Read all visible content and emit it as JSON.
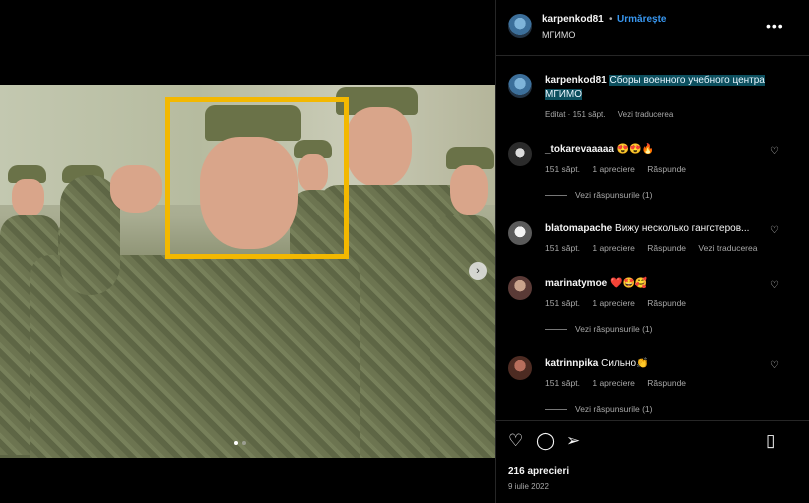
{
  "post": {
    "photo_alt": "soldier-group-photo",
    "highlight_color": "#f3b800"
  },
  "header": {
    "username": "karpenkod81",
    "separator": "•",
    "follow_label": "Urmărește",
    "subtitle": "МГИМО",
    "more": "•••"
  },
  "caption": {
    "username": "karpenkod81",
    "text": "Сборы военного учебного центра МГИМО",
    "edited": "Editat · 151 săpt.",
    "translate": "Vezi traducerea"
  },
  "comments": [
    {
      "username": "_tokarevaaaaa",
      "text": "😍😍🔥",
      "time": "151 săpt.",
      "likes": "1 apreciere",
      "reply": "Răspunde",
      "translate": "",
      "replies": "Vezi răspunsurile (1)"
    },
    {
      "username": "blatomapache",
      "text": "Вижу несколько гангстеров...",
      "time": "151 săpt.",
      "likes": "1 apreciere",
      "reply": "Răspunde",
      "translate": "Vezi traducerea",
      "replies": ""
    },
    {
      "username": "marinatymoe",
      "text": "❤️🤩🥰",
      "time": "151 săpt.",
      "likes": "1 apreciere",
      "reply": "Răspunde",
      "translate": "",
      "replies": "Vezi răspunsurile (1)"
    },
    {
      "username": "katrinnpika",
      "text": "Сильно👏",
      "time": "151 săpt.",
      "likes": "1 apreciere",
      "reply": "Răspunde",
      "translate": "",
      "replies": "Vezi răspunsurile (1)"
    }
  ],
  "actions": {
    "like_icon": "heart-icon",
    "comment_icon": "comment-icon",
    "share_icon": "share-icon",
    "save_icon": "bookmark-icon",
    "likes_count": "216 aprecieri",
    "date": "9 iulie 2022"
  },
  "colors": {
    "background": "#000000",
    "link_blue": "#3897f0",
    "muted": "#a8a8a8",
    "caption_highlight": "#0c4f5e"
  }
}
